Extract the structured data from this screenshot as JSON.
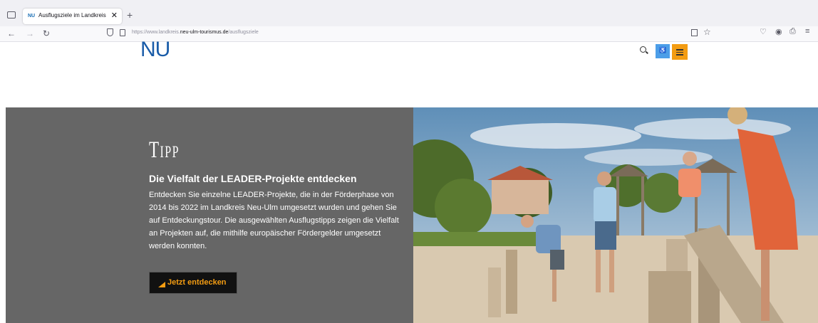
{
  "browser": {
    "tab_title": "Ausflugsziele im Landkreis Neu",
    "tab_favicon_text": "NU",
    "url_prefix": "https://www.landkreis.",
    "url_domain": "neu-ulm-tourismus.de",
    "url_path": "/ausflugsziele"
  },
  "header": {
    "logo_text": "NU",
    "accessibility_icon": "accessibility-icon",
    "search_icon": "search-icon",
    "menu_icon": "hamburger-menu-icon",
    "access_color": "#4c9ee8",
    "menu_color": "#f39c12"
  },
  "teaser": {
    "kicker": "Tipp",
    "heading": "Die Vielfalt der LEADER-Projekte entdecken",
    "body": "Entdecken Sie einzelne LEADER-Projekte, die in der Förderphase von 2014 bis 2022 im Landkreis Neu-Ulm umgesetzt wurden und gehen Sie auf Entdeckungstour. Die ausgewählten Ausflugstipps zeigen die Vielfalt an Projekten auf, die mithilfe europäischer Fördergelder umgesetzt werden konnten.",
    "cta_label": "Jetzt entdecken",
    "background_color": "#666666",
    "accent_color": "#f39c12"
  }
}
